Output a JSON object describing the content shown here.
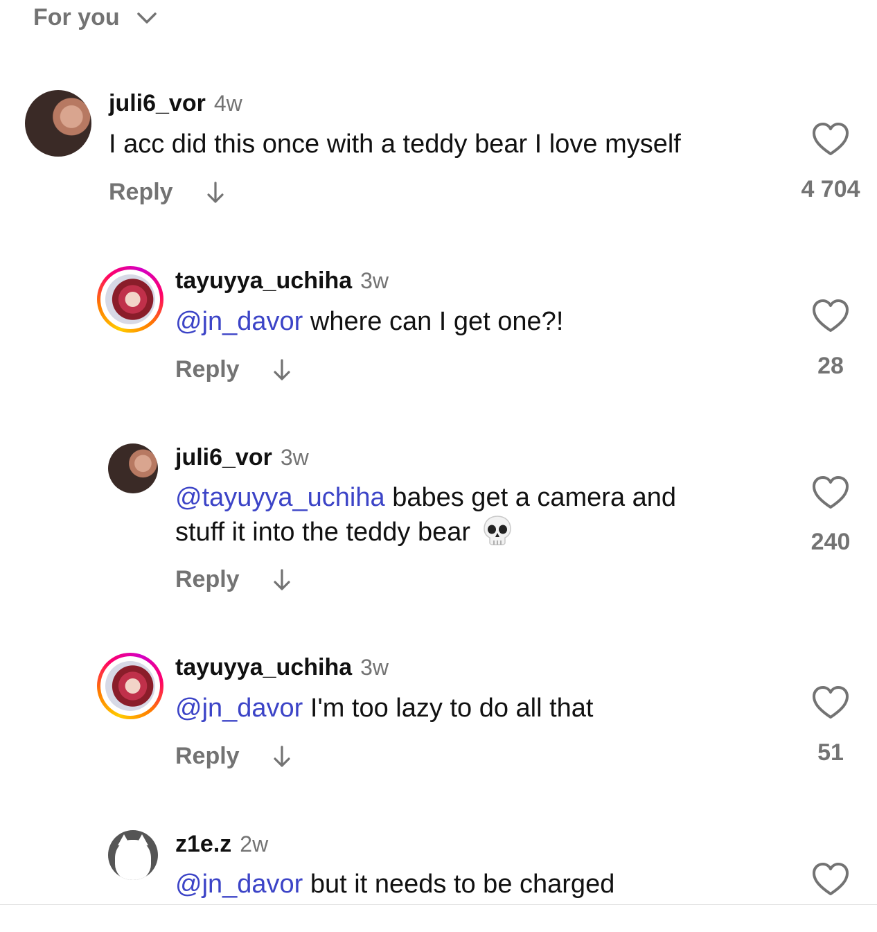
{
  "filter": {
    "label": "For you"
  },
  "comments": [
    {
      "username": "juli6_vor",
      "time": "4w",
      "mention": "",
      "text": "I acc did this once with a teddy bear I love myself",
      "reply_label": "Reply",
      "likes": "4 704"
    },
    {
      "username": "tayuyya_uchiha",
      "time": "3w",
      "mention": "@jn_davor",
      "text": " where can I get one?!",
      "reply_label": "Reply",
      "likes": "28"
    },
    {
      "username": "juli6_vor",
      "time": "3w",
      "mention": "@tayuyya_uchiha",
      "text": " babes get a camera and",
      "text_line2": "stuff it into the teddy bear",
      "reply_label": "Reply",
      "likes": "240"
    },
    {
      "username": "tayuyya_uchiha",
      "time": "3w",
      "mention": "@jn_davor",
      "text": " I'm too lazy to do all that",
      "reply_label": "Reply",
      "likes": "51"
    },
    {
      "username": "z1e.z",
      "time": "2w",
      "mention": "@jn_davor",
      "text": " but it needs to be charged"
    }
  ]
}
